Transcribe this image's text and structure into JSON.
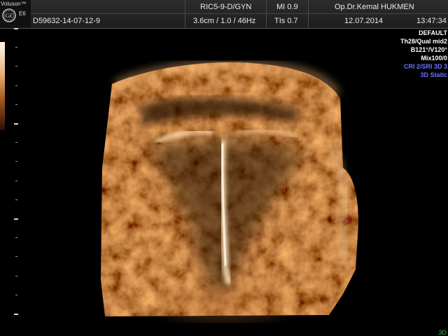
{
  "header": {
    "brand": "Voluson™",
    "model": "E6",
    "logo_text": "GE",
    "probe": "RIC5-9-D/GYN",
    "mi": "MI  0.9",
    "doctor": "Op.Dr.Kemal HUKMEN",
    "patient_id": "D59632-14-07-12-9",
    "depth": "3.6cm / 1.0 / 46Hz",
    "tis": "TIs  0.7",
    "date": "12.07.2014",
    "time": "13:47:34"
  },
  "info_panel": {
    "line1": "DEFAULT",
    "line2": "Th28/Qual mid2",
    "line3": "B121°/V120°",
    "line4": "Mix100/0",
    "line5": "CRI 2/SRI 3D 3",
    "line6": "3D Static"
  },
  "status": {
    "mode_3d": "3D"
  },
  "colors": {
    "background": "#000000",
    "header": "#262626",
    "text": "#ffffff",
    "accent_blue": "#6f6fff",
    "tissue_light": "#f4d2a0",
    "tissue_mid": "#b8692a",
    "tissue_dark": "#3a1604",
    "mode_green": "#42c242"
  },
  "icons": {
    "logo": "ge-logo-icon"
  }
}
